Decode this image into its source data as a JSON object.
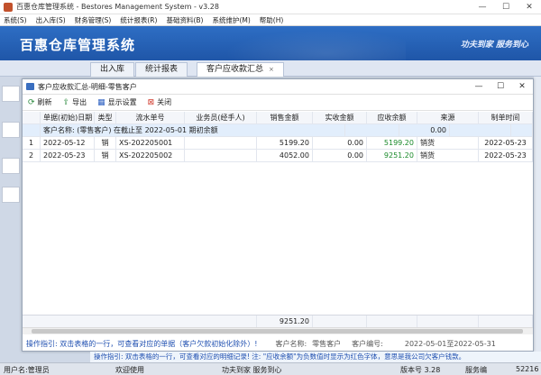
{
  "app": {
    "title": "百惠仓库管理系统 - Bestores Management System - v3.28",
    "brand": "百惠仓库管理系统",
    "slogan": "功夫到家  服务到心"
  },
  "menu": [
    "系统(S)",
    "出入库(S)",
    "财务管理(S)",
    "统计报表(R)",
    "基础资料(B)",
    "系统维护(M)",
    "帮助(H)"
  ],
  "tabs": {
    "items": [
      "出入库",
      "统计报表",
      "客户应收款汇总"
    ],
    "active_close": "×"
  },
  "dialog": {
    "title": "客户应收款汇总-明细-零售客户",
    "toolbar": {
      "refresh": "刷新",
      "export": "导出",
      "display_settings": "显示设置",
      "close": "关闭"
    },
    "columns": [
      "单据(初始)日期",
      "类型",
      "流水单号",
      "业务员(经手人)",
      "销售金额",
      "实收金额",
      "应收余额",
      "来源",
      "制单时间"
    ],
    "opening": {
      "label": "客户名称: (零售客户) 在截止至 2022-05-01 期初余额",
      "balance": "0.00"
    },
    "rows": [
      {
        "idx": "1",
        "date": "2022-05-12",
        "type": "销",
        "serial": "XS-202205001",
        "staff": "",
        "sales": "5199.20",
        "received": "0.00",
        "balance": "5199.20",
        "source": "销货",
        "created": "2022-05-23"
      },
      {
        "idx": "2",
        "date": "2022-05-23",
        "type": "销",
        "serial": "XS-202205002",
        "staff": "",
        "sales": "4052.00",
        "received": "0.00",
        "balance": "9251.20",
        "source": "销货",
        "created": "2022-05-23"
      }
    ],
    "total_sales": "9251.20",
    "footer": {
      "guide": "操作指引: 双击表格的一行，可查看对应的单据（客户欠款初始化除外）!",
      "customer_label": "客户名称:",
      "customer_value": "零售客户",
      "code_label": "客户编号:",
      "date_range": "2022-05-01至2022-05-31"
    }
  },
  "guidebar": "操作指引: 双击表格的一行，可查看对应的明细记录! 注: \"应收余额\"为负数值时显示为红色字体，意思是我公司欠客户钱款。",
  "status": {
    "user": "用户名:管理员",
    "welcome": "欢迎使用",
    "service": "功夫到家  服务到心",
    "version": "版本号 3.28",
    "service_no_label": "服务编",
    "service_no": "52216"
  },
  "colors": {
    "banner": "#1f56a8",
    "balance_positive": "#1a8a2a",
    "guide_text": "#1f4fb0"
  }
}
